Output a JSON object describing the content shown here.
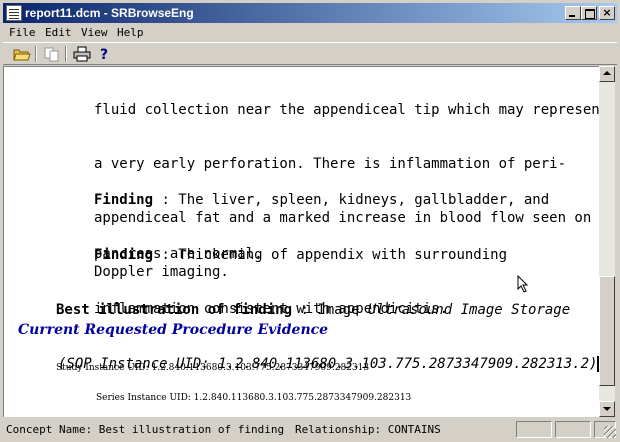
{
  "window": {
    "title": "report11.dcm - SRBrowseEng",
    "minimize_label": "_",
    "maximize_label": "",
    "close_label": "×"
  },
  "menu": {
    "file": "File",
    "edit": "Edit",
    "view": "View",
    "help": "Help"
  },
  "toolbar": {
    "icons": [
      "open-folder-icon",
      "copy-icon",
      "print-icon",
      "help-icon"
    ]
  },
  "document": {
    "para1_lines": [
      "fluid collection near the appendiceal tip which may represent",
      "a very early perforation. There is inflammation of peri-",
      "appendiceal fat and a marked increase in blood flow seen on",
      "Doppler imaging."
    ],
    "finding2_label": "Finding",
    "finding2_text": " : The liver, spleen, kidneys, gallbladder, and",
    "finding2_line2": "pancreas are normal.",
    "finding3_label": "Finding",
    "finding3_text": " : Thickening of appendix with surrounding",
    "finding3_line2": "inflammation consistent with appendicitis.",
    "best_label": "Best illustration of finding",
    "best_sep": " : Image ",
    "best_type": "Ultrasound Image Storage",
    "best_uid_line": "(SOP Instance UID: 1.2.840.113680.3.103.775.2873347909.282313.2)",
    "section_title": "Current Requested Procedure Evidence",
    "study_line": "Study Instance UID: 1.2.840.113680.3.103.775.2873347909.282313",
    "series_line": "Series Instance UID: 1.2.840.113680.3.103.775.2873347909.282313"
  },
  "statusbar": {
    "concept": "Concept Name: Best illustration of finding",
    "relationship": "Relationship: CONTAINS"
  }
}
